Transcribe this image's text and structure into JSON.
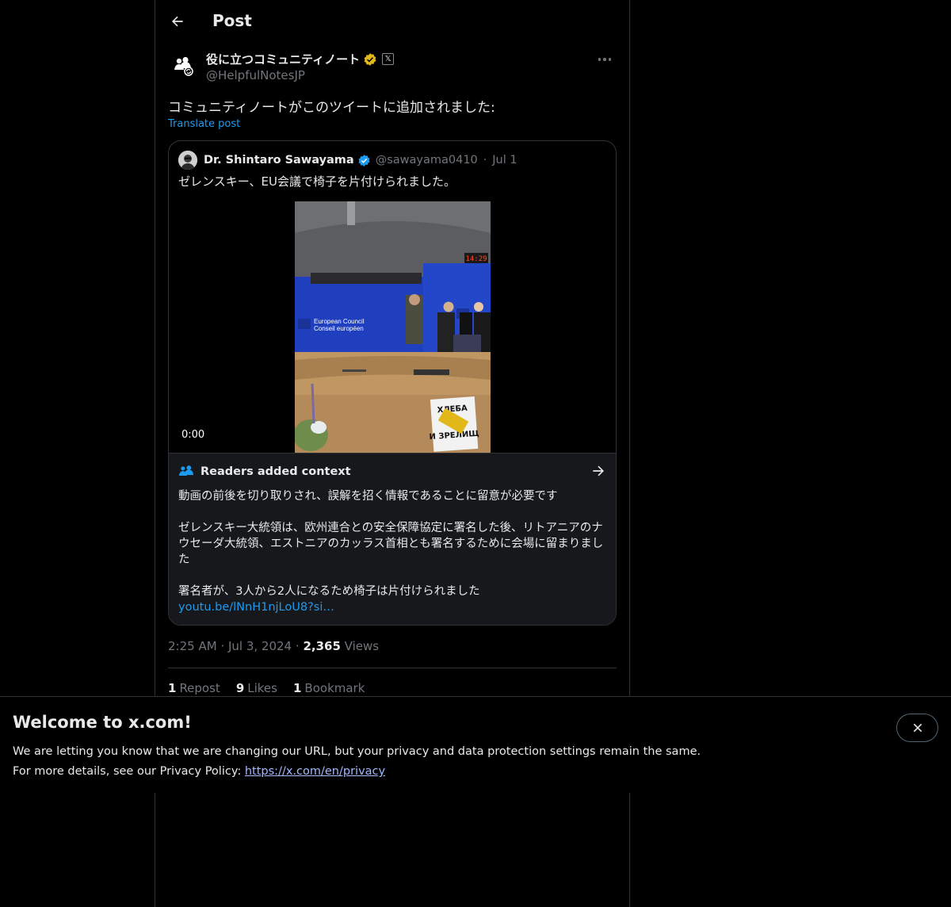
{
  "header": {
    "title": "Post"
  },
  "post": {
    "author_name": "役に立つコミュニティノート",
    "author_handle": "@HelpfulNotesJP",
    "text": "コミュニティノートがこのツイートに追加されました:",
    "translate_label": "Translate post",
    "time": "2:25 AM",
    "date": "Jul 3, 2024",
    "views_count": "2,365",
    "views_label": "Views",
    "reposts_count": "1",
    "reposts_label": "Repost",
    "likes_count": "9",
    "likes_label": "Likes",
    "bookmarks_count": "1",
    "bookmarks_label": "Bookmark"
  },
  "quoted": {
    "author_name": "Dr. Shintaro Sawayama",
    "author_handle": "@sawayama0410",
    "date": "Jul 1",
    "text": "ゼレンスキー、EU会議で椅子を片付けられました。",
    "video_time": "0:00",
    "video_clock": "14:29",
    "video_sign_line1": "European Council",
    "video_sign_line2": "Conseil européen",
    "video_sticker_line1": "ХЛЕБА",
    "video_sticker_line2": "И ЗРЕЛИЩ"
  },
  "notes": {
    "header": "Readers added context",
    "para1": "動画の前後を切り取りされ、誤解を招く情報であることに留意が必要です",
    "para2": "ゼレンスキー大統領は、欧州連合との安全保障協定に署名した後、リトアニアのナウセーダ大統領、エストニアのカッラス首相とも署名するために会場に留まりました",
    "para3": "署名者が、3人から2人になるため椅子は片付けられました",
    "link": "youtu.be/lNnH1njLoU8?si…"
  },
  "banner": {
    "title": "Welcome to x.com!",
    "line1": "We are letting you know that we are changing our URL, but your privacy and data protection settings remain the same.",
    "line2_prefix": "For more details, see our Privacy Policy: ",
    "link": "https://x.com/en/privacy"
  },
  "colors": {
    "background": "#000000",
    "accent": "#1d9bf0",
    "muted": "#71767b",
    "gold_badge": "#e2b719",
    "eu_blue": "#1f3fbf"
  },
  "icons": [
    "back-arrow-icon",
    "community-notes-icon",
    "gold-verified-icon",
    "x-affiliate-icon",
    "more-icon",
    "blue-verified-icon",
    "readers-icon",
    "right-arrow-icon",
    "close-icon"
  ]
}
